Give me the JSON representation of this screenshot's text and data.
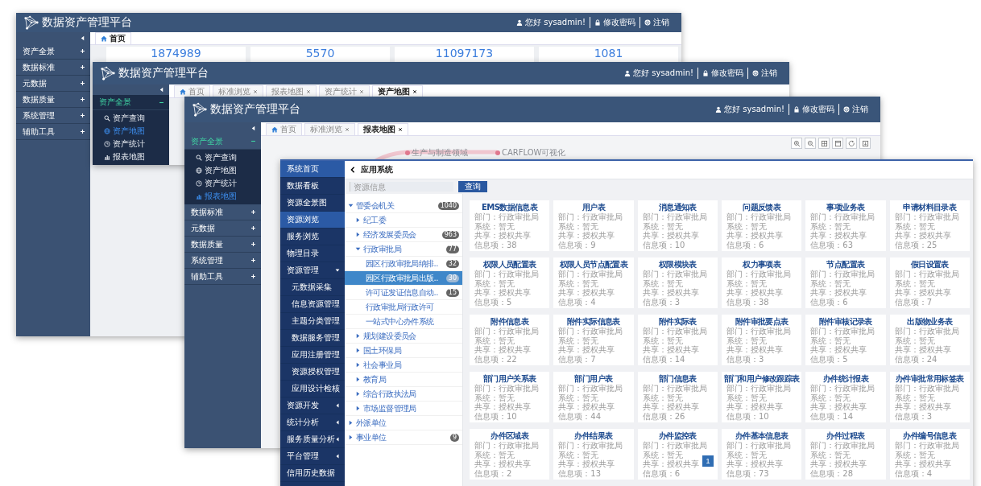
{
  "windows": [
    {
      "title": "数据资产管理平台",
      "user": "您好 sysadmin!",
      "change_password": "修改密码",
      "logout": "注销",
      "menu": [
        {
          "label": "资产全景",
          "expanded": false
        },
        {
          "label": "数据标准",
          "expanded": false
        },
        {
          "label": "元数据",
          "expanded": false
        },
        {
          "label": "数据质量",
          "expanded": false
        },
        {
          "label": "系统管理",
          "expanded": false
        },
        {
          "label": "辅助工具",
          "expanded": false
        }
      ],
      "tabs": [
        {
          "label": "首页",
          "selected": true,
          "closable": false
        }
      ],
      "stats": [
        "1874989",
        "5570",
        "11097173",
        "1081"
      ]
    },
    {
      "title": "数据资产管理平台",
      "user": "您好 sysadmin!",
      "change_password": "修改密码",
      "logout": "注销",
      "menu": [
        {
          "label": "资产全景",
          "expanded": true,
          "children": [
            {
              "label": "资产查询",
              "selected": false
            },
            {
              "label": "资产地图",
              "selected": true
            },
            {
              "label": "资产统计",
              "selected": false
            },
            {
              "label": "报表地图",
              "selected": false
            }
          ]
        }
      ],
      "tabs": [
        {
          "label": "首页",
          "selected": false,
          "closable": false
        },
        {
          "label": "标准浏览",
          "selected": false,
          "closable": true
        },
        {
          "label": "报表地图",
          "selected": false,
          "closable": true
        },
        {
          "label": "资产统计",
          "selected": false,
          "closable": true
        },
        {
          "label": "资产地图",
          "selected": true,
          "closable": true
        }
      ]
    },
    {
      "title": "数据资产管理平台",
      "user": "您好 sysadmin!",
      "change_password": "修改密码",
      "logout": "注销",
      "menu": [
        {
          "label": "资产全景",
          "expanded": true,
          "children": [
            {
              "label": "资产查询",
              "selected": false
            },
            {
              "label": "资产地图",
              "selected": false
            },
            {
              "label": "资产统计",
              "selected": false
            },
            {
              "label": "报表地图",
              "selected": true
            }
          ]
        },
        {
          "label": "数据标准",
          "expanded": false
        },
        {
          "label": "元数据",
          "expanded": false
        },
        {
          "label": "数据质量",
          "expanded": false
        },
        {
          "label": "系统管理",
          "expanded": false
        },
        {
          "label": "辅助工具",
          "expanded": false
        }
      ],
      "tabs": [
        {
          "label": "首页",
          "selected": false,
          "closable": false
        },
        {
          "label": "标准浏览",
          "selected": false,
          "closable": true
        },
        {
          "label": "报表地图",
          "selected": true,
          "closable": true
        }
      ],
      "graph_nodes": [
        "生产与制造领域",
        "CARFLOW可视化"
      ]
    }
  ],
  "front": {
    "nav": [
      {
        "label": "系统首页",
        "kind": "link",
        "selected": true
      },
      {
        "label": "数据看板",
        "kind": "link",
        "selected": false
      },
      {
        "label": "资源全景图",
        "kind": "link",
        "selected": false
      },
      {
        "label": "资源浏览",
        "kind": "link",
        "selected": true
      },
      {
        "label": "服务浏览",
        "kind": "link",
        "selected": false
      },
      {
        "label": "物理目录",
        "kind": "link",
        "selected": false
      },
      {
        "label": "资源管理",
        "kind": "group",
        "selected": false,
        "expanded": true,
        "children": [
          {
            "label": "元数据采集",
            "selected": false
          },
          {
            "label": "信息资源管理",
            "selected": false
          },
          {
            "label": "主题分类管理",
            "selected": false
          },
          {
            "label": "数据服务管理",
            "selected": false
          },
          {
            "label": "应用注册管理",
            "selected": false
          },
          {
            "label": "资源授权管理",
            "selected": false
          },
          {
            "label": "应用设计检核",
            "selected": false
          }
        ]
      },
      {
        "label": "资源开发",
        "kind": "group",
        "selected": false,
        "expanded": false
      },
      {
        "label": "统计分析",
        "kind": "group",
        "selected": false,
        "expanded": false
      },
      {
        "label": "服务质量分析",
        "kind": "group",
        "selected": false,
        "expanded": false
      },
      {
        "label": "平台管理",
        "kind": "group",
        "selected": false,
        "expanded": false
      },
      {
        "label": "信用历史数据",
        "kind": "link",
        "selected": false
      }
    ],
    "heading": "应用系统",
    "search": {
      "placeholder": "资源信息",
      "button": "查询"
    },
    "tree": [
      {
        "label": "管委会机关",
        "count": "1040",
        "expanded": true,
        "selected": false,
        "children": [
          {
            "label": "纪工委",
            "expanded": false,
            "selected": false
          },
          {
            "label": "经济发展委员会",
            "count": "963",
            "expanded": false,
            "selected": false
          },
          {
            "label": "行政审批局",
            "count": "77",
            "expanded": true,
            "selected": false,
            "children": [
              {
                "label": "园区行政审批局纳排..",
                "count": "32",
                "selected": false
              },
              {
                "label": "园区行政审批局出版..",
                "count": "30",
                "selected": true
              },
              {
                "label": "许可证发证信息自动..",
                "count": "15",
                "selected": false
              },
              {
                "label": "行政审批局行政许可",
                "selected": false
              },
              {
                "label": "一站式中心办件系统",
                "selected": false
              }
            ]
          },
          {
            "label": "规划建设委员会",
            "expanded": false,
            "selected": false
          },
          {
            "label": "国土环保局",
            "expanded": false,
            "selected": false
          },
          {
            "label": "社会事业局",
            "expanded": false,
            "selected": false
          },
          {
            "label": "教育局",
            "expanded": false,
            "selected": false
          },
          {
            "label": "综合行政执法局",
            "expanded": false,
            "selected": false
          },
          {
            "label": "市场监督管理局",
            "expanded": false,
            "selected": false
          }
        ]
      },
      {
        "label": "外派单位",
        "expanded": false,
        "selected": false
      },
      {
        "label": "事业单位",
        "count": "9",
        "expanded": false,
        "selected": false
      }
    ],
    "cards": [
      {
        "title": "EMS数据信息表",
        "lines": [
          "部门：行政审批局",
          "系统：暂无",
          "共享：授权共享",
          "信息项：38"
        ]
      },
      {
        "title": "用户表",
        "lines": [
          "部门：行政审批局",
          "系统：暂无",
          "共享：授权共享",
          "信息项：9"
        ]
      },
      {
        "title": "消息通知表",
        "lines": [
          "部门：行政审批局",
          "系统：暂无",
          "共享：授权共享",
          "信息项：10"
        ]
      },
      {
        "title": "问题反馈表",
        "lines": [
          "部门：行政审批局",
          "系统：暂无",
          "共享：授权共享",
          "信息项：6"
        ]
      },
      {
        "title": "事项业务表",
        "lines": [
          "部门：行政审批局",
          "系统：暂无",
          "共享：授权共享",
          "信息项：63"
        ]
      },
      {
        "title": "申请材料目录表",
        "lines": [
          "部门：行政审批局",
          "系统：暂无",
          "共享：授权共享",
          "信息项：25"
        ]
      },
      {
        "title": "权限人员配置表",
        "lines": [
          "部门：行政审批局",
          "系统：暂无",
          "共享：授权共享",
          "信息项：5"
        ]
      },
      {
        "title": "权限人员节点配置表",
        "lines": [
          "部门：行政审批局",
          "系统：暂无",
          "共享：授权共享",
          "信息项：4"
        ]
      },
      {
        "title": "权限模块表",
        "lines": [
          "部门：行政审批局",
          "系统：暂无",
          "共享：授权共享",
          "信息项：3"
        ]
      },
      {
        "title": "权力事项表",
        "lines": [
          "部门：行政审批局",
          "系统：暂无",
          "共享：授权共享",
          "信息项：38"
        ]
      },
      {
        "title": "节点配置表",
        "lines": [
          "部门：行政审批局",
          "系统：暂无",
          "共享：授权共享",
          "信息项：6"
        ]
      },
      {
        "title": "假日设置表",
        "lines": [
          "部门：行政审批局",
          "系统：暂无",
          "共享：授权共享",
          "信息项：7"
        ]
      },
      {
        "title": "附件信息表",
        "lines": [
          "部门：行政审批局",
          "系统：暂无",
          "共享：授权共享",
          "信息项：22"
        ]
      },
      {
        "title": "附件实际信息表",
        "lines": [
          "部门：行政审批局",
          "系统：暂无",
          "共享：授权共享",
          "信息项：7"
        ]
      },
      {
        "title": "附件实际表",
        "lines": [
          "部门：行政审批局",
          "系统：暂无",
          "共享：授权共享",
          "信息项：14"
        ]
      },
      {
        "title": "附件审批要点表",
        "lines": [
          "部门：行政审批局",
          "系统：暂无",
          "共享：授权共享",
          "信息项：3"
        ]
      },
      {
        "title": "附件审核记录表",
        "lines": [
          "部门：行政审批局",
          "系统：暂无",
          "共享：授权共享",
          "信息项：5"
        ]
      },
      {
        "title": "出版物业务表",
        "lines": [
          "部门：行政审批局",
          "系统：暂无",
          "共享：授权共享",
          "信息项：24"
        ]
      },
      {
        "title": "部门用户关系表",
        "lines": [
          "部门：行政审批局",
          "系统：暂无",
          "共享：授权共享",
          "信息项：10"
        ]
      },
      {
        "title": "部门用户表",
        "lines": [
          "部门：行政审批局",
          "系统：暂无",
          "共享：授权共享",
          "信息项：44"
        ]
      },
      {
        "title": "部门信息表",
        "lines": [
          "部门：行政审批局",
          "系统：暂无",
          "共享：授权共享",
          "信息项：26"
        ]
      },
      {
        "title": "部门和用户修改跟踪表",
        "lines": [
          "部门：行政审批局",
          "系统：暂无",
          "共享：授权共享",
          "信息项：10"
        ]
      },
      {
        "title": "办件统计报表",
        "lines": [
          "部门：行政审批局",
          "系统：暂无",
          "共享：授权共享",
          "信息项：14"
        ]
      },
      {
        "title": "办件审批常用标签表",
        "lines": [
          "部门：行政审批局",
          "系统：暂无",
          "共享：授权共享",
          "信息项：3"
        ]
      },
      {
        "title": "办件区域表",
        "lines": [
          "部门：行政审批局",
          "系统：暂无",
          "共享：授权共享",
          "信息项：2"
        ]
      },
      {
        "title": "办件结果表",
        "lines": [
          "部门：行政审批局",
          "系统：暂无",
          "共享：授权共享",
          "信息项：13"
        ]
      },
      {
        "title": "办件监控表",
        "lines": [
          "部门：行政审批局",
          "系统：暂无",
          "共享：授权共享",
          "信息项：6"
        ]
      },
      {
        "title": "办件基本信息表",
        "lines": [
          "部门：行政审批局",
          "系统：暂无",
          "共享：授权共享",
          "信息项：73"
        ]
      },
      {
        "title": "办件过程表",
        "lines": [
          "部门：行政审批局",
          "系统：暂无",
          "共享：授权共享",
          "信息项：28"
        ]
      },
      {
        "title": "办件编号信息表",
        "lines": [
          "部门：行政审批局",
          "系统：暂无",
          "共享：授权共享",
          "信息项：4"
        ]
      }
    ],
    "pagination": [
      {
        "label": "1",
        "selected": true
      }
    ]
  }
}
